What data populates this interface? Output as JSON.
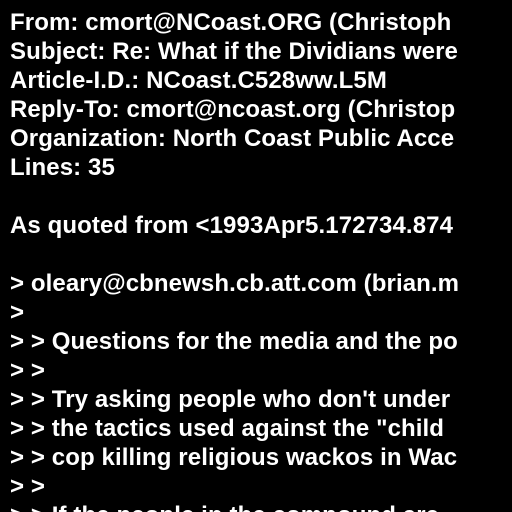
{
  "colors": {
    "background": "#000000",
    "text": "#ffffff"
  },
  "headers": {
    "from": "From: cmort@NCoast.ORG (Christoph",
    "subject": "Subject: Re: What if the Dividians were",
    "article_id": "Article-I.D.: NCoast.C528ww.L5M",
    "reply_to": "Reply-To: cmort@ncoast.org (Christop",
    "organization": "Organization: North Coast Public Acce",
    "lines": "Lines: 35"
  },
  "body": {
    "attribution": "As quoted from <1993Apr5.172734.874",
    "quote_lines": [
      "> oleary@cbnewsh.cb.att.com (brian.m",
      ">",
      "> > Questions for the media and the po",
      "> >",
      "> > Try asking people who don't under",
      "> > the tactics used against the \"child",
      "> > cop killing religious wackos in Wac",
      "> >",
      "> > If the people in the compound are"
    ]
  }
}
